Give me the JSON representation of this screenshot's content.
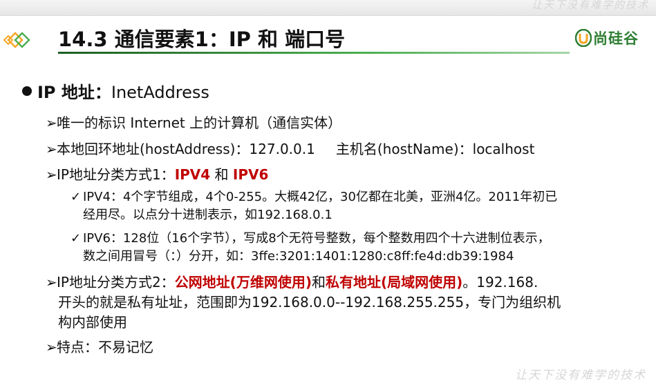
{
  "watermark": {
    "top": "让天下没有难学的技术",
    "bottom": "让天下没有难学的技术"
  },
  "header": {
    "title": "14.3 通信要素1：IP 和 端口号",
    "brand": "尚硅谷",
    "brand_icon": "u-shield-icon",
    "accent": "#2e7d32"
  },
  "content": {
    "bullet1": {
      "head": "IP 地址：",
      "text": "InetAddress"
    },
    "item1": "唯一的标识 Internet 上的计算机（通信实体）",
    "item2": {
      "left": "本地回环地址(hostAddress)：127.0.0.1",
      "right": "主机名(hostName)：localhost"
    },
    "item3": {
      "prefix": "IP地址分类方式1：",
      "a": "IPV4",
      "mid": " 和 ",
      "b": "IPV6"
    },
    "ipv4": {
      "line1": "IPV4：4个字节组成，4个0-255。大概42亿，30亿都在北美，亚洲4亿。2011年初已",
      "line2": "经用尽。以点分十进制表示，如192.168.0.1"
    },
    "ipv6": {
      "line1": "IPV6：128位（16个字节），写成8个无符号整数，每个整数用四个十六进制位表示，",
      "line2": "数之间用冒号（：）分开，如：3ffe:3201:1401:1280:c8ff:fe4d:db39:1984"
    },
    "item4": {
      "prefix": "IP地址分类方式2：",
      "public": "公网地址(万维网使用)",
      "and": "和",
      "private": "私有地址(局域网使用)",
      "suffix": "。192.168.",
      "line2": "开头的就是私有址址，范围即为192.168.0.0--192.168.255.255，专门为组织机",
      "line3": "构内部使用"
    },
    "item5": "特点：不易记忆",
    "red": "#c00000"
  }
}
